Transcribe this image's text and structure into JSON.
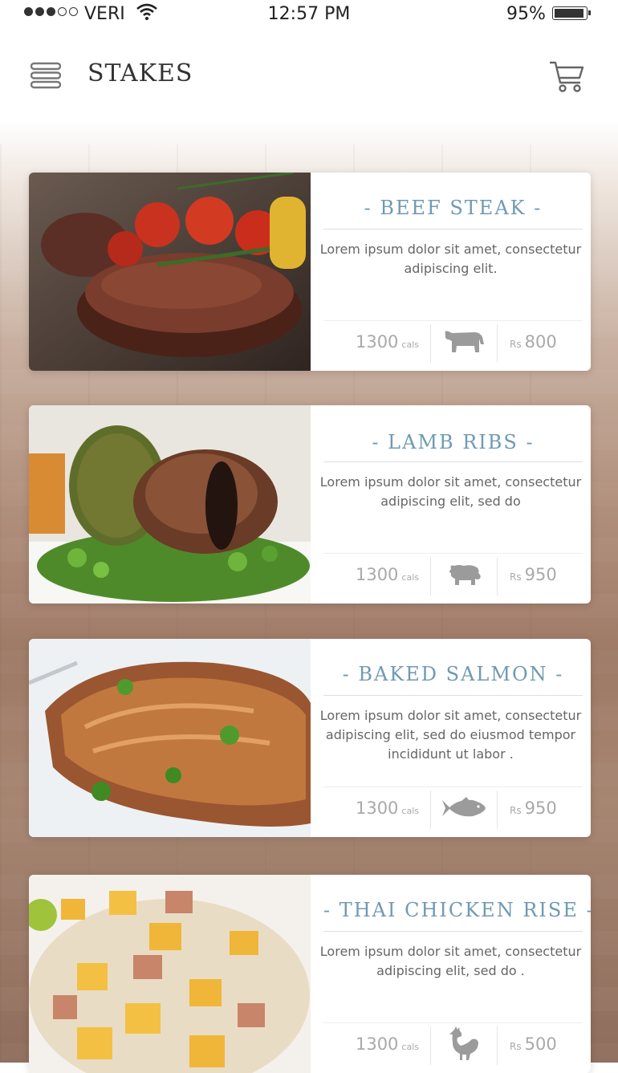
{
  "status_bar": {
    "carrier": "VERI",
    "time": "12:57 PM",
    "battery": "95%"
  },
  "header": {
    "title": "STAKES"
  },
  "menu": [
    {
      "name": "- BEEF STEAK -",
      "description": "Lorem ipsum dolor sit amet, consectetur adipiscing elit.",
      "calories": "1300",
      "cal_unit": "cals",
      "animal_icon": "cow-icon",
      "currency": "Rs",
      "price": "800"
    },
    {
      "name": "- LAMB RIBS -",
      "description": "Lorem ipsum dolor sit amet, consectetur adipiscing elit, sed do",
      "calories": "1300",
      "cal_unit": "cals",
      "animal_icon": "lamb-icon",
      "currency": "Rs",
      "price": "950"
    },
    {
      "name": "- BAKED SALMON -",
      "description": "Lorem ipsum dolor sit amet, consectetur adipiscing elit, sed do eiusmod tempor incididunt ut labor .",
      "calories": "1300",
      "cal_unit": "cals",
      "animal_icon": "fish-icon",
      "currency": "Rs",
      "price": "950"
    },
    {
      "name": "- THAI CHICKEN RISE -",
      "description": "Lorem ipsum dolor sit amet, consectetur adipiscing elit, sed do .",
      "calories": "1300",
      "cal_unit": "cals",
      "animal_icon": "chicken-icon",
      "currency": "Rs",
      "price": "500"
    }
  ],
  "colors": {
    "accent": "#6f9ab3",
    "muted_text": "#a9a9a9"
  }
}
